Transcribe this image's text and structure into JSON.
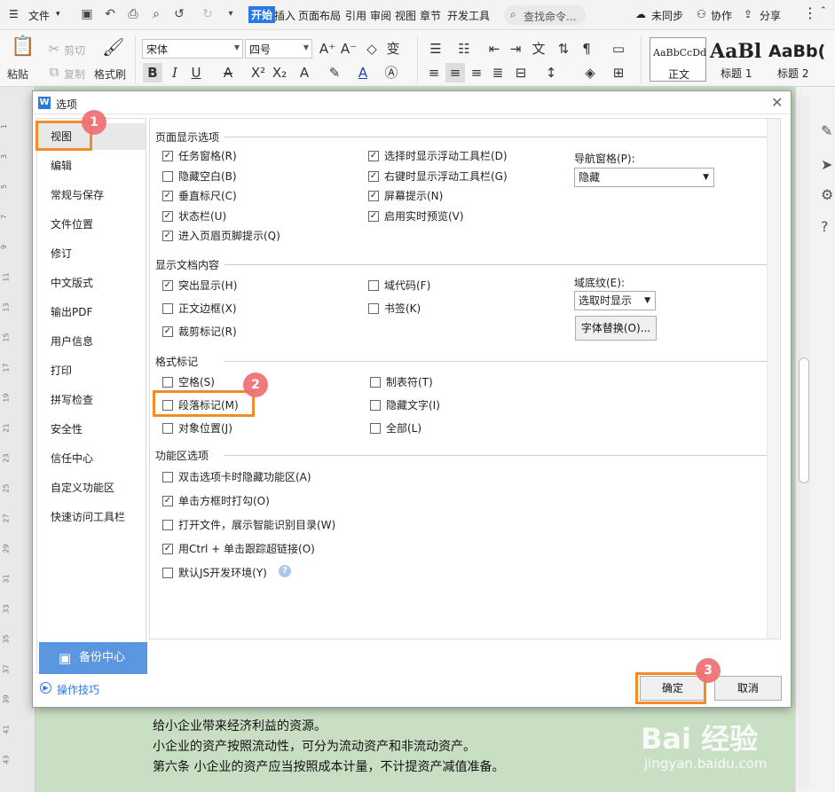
{
  "menubar": {
    "file": "文件",
    "tabs": [
      "开始",
      "插入",
      "页面布局",
      "引用",
      "审阅",
      "视图",
      "章节",
      "开发工具"
    ],
    "search": "查找命令...",
    "sync": "未同步",
    "collab": "协作",
    "share": "分享"
  },
  "ribbon": {
    "paste": "粘贴",
    "cut": "剪切",
    "copy": "复制",
    "format_painter": "格式刷",
    "font_name": "宋体",
    "font_size": "四号",
    "styles": [
      {
        "preview": "AaBbCcDd",
        "name": "正文"
      },
      {
        "preview": "AaBl",
        "name": "标题 1"
      },
      {
        "preview": "AaBb(",
        "name": "标题 2"
      }
    ]
  },
  "document": {
    "lines": [
      "给小企业带来经济利益的资源。",
      "小企业的资产按照流动性，可分为流动资产和非流动资产。",
      "第六条  小企业的资产应当按照成本计量，不计提资产减值准备。"
    ]
  },
  "watermark": {
    "brand": "Bai  经验",
    "url": "jingyan.baidu.com"
  },
  "dialog": {
    "title": "选项",
    "nav": [
      "视图",
      "编辑",
      "常规与保存",
      "文件位置",
      "修订",
      "中文版式",
      "输出PDF",
      "用户信息",
      "打印",
      "拼写检查",
      "安全性",
      "信任中心",
      "自定义功能区",
      "快速访问工具栏"
    ],
    "backup": "备份中心",
    "tips": "操作技巧",
    "ok": "确定",
    "cancel": "取消",
    "sections": {
      "page_display": {
        "title": "页面显示选项",
        "col1": [
          {
            "label": "任务窗格(R)",
            "checked": true
          },
          {
            "label": "隐藏空白(B)",
            "checked": false
          },
          {
            "label": "垂直标尺(C)",
            "checked": true
          },
          {
            "label": "状态栏(U)",
            "checked": true
          },
          {
            "label": "进入页眉页脚提示(Q)",
            "checked": true
          }
        ],
        "col2": [
          {
            "label": "选择时显示浮动工具栏(D)",
            "checked": true
          },
          {
            "label": "右键时显示浮动工具栏(G)",
            "checked": true
          },
          {
            "label": "屏幕提示(N)",
            "checked": true
          },
          {
            "label": "启用实时预览(V)",
            "checked": true
          }
        ],
        "nav_pane_label": "导航窗格(P):",
        "nav_pane_value": "隐藏"
      },
      "doc_content": {
        "title": "显示文档内容",
        "col1": [
          {
            "label": "突出显示(H)",
            "checked": true
          },
          {
            "label": "正文边框(X)",
            "checked": false
          },
          {
            "label": "裁剪标记(R)",
            "checked": true
          }
        ],
        "col2": [
          {
            "label": "域代码(F)",
            "checked": false
          },
          {
            "label": "书签(K)",
            "checked": false
          }
        ],
        "field_shading_label": "域底纹(E):",
        "field_shading_value": "选取时显示",
        "font_sub_button": "字体替换(O)..."
      },
      "format_marks": {
        "title": "格式标记",
        "col1": [
          {
            "label": "空格(S)",
            "checked": false
          },
          {
            "label": "段落标记(M)",
            "checked": false
          },
          {
            "label": "对象位置(J)",
            "checked": false
          }
        ],
        "col2": [
          {
            "label": "制表符(T)",
            "checked": false
          },
          {
            "label": "隐藏文字(I)",
            "checked": false
          },
          {
            "label": "全部(L)",
            "checked": false
          }
        ]
      },
      "ribbon_opts": {
        "title": "功能区选项",
        "items": [
          {
            "label": "双击选项卡时隐藏功能区(A)",
            "checked": false
          },
          {
            "label": "单击方框时打勾(O)",
            "checked": true
          },
          {
            "label": "打开文件，展示智能识别目录(W)",
            "checked": false
          },
          {
            "label": "用Ctrl + 单击跟踪超链接(O)",
            "checked": true
          },
          {
            "label": "默认JS开发环境(Y)",
            "checked": false
          }
        ]
      }
    }
  },
  "annotations": [
    "1",
    "2",
    "3"
  ],
  "colors": {
    "accent": "#2b78e4",
    "highlight": "#f28c28",
    "badge": "#ee6f74",
    "doc_bg": "#c9dfc3"
  }
}
